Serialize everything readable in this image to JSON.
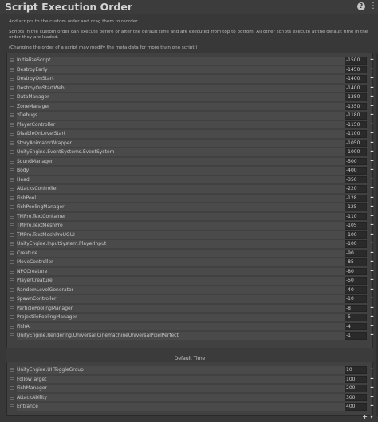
{
  "window": {
    "title": "Script Execution Order"
  },
  "description": {
    "line1": "Add scripts to the custom order and drag them to reorder.",
    "line2": "Scripts in the custom order can execute before or after the default time and are executed from top to bottom. All other scripts execute at the default time in the order they are loaded.",
    "line3": "(Changing the order of a script may modify the meta data for more than one script.)"
  },
  "before_default": [
    {
      "name": "InitializeScript",
      "value": "-1500"
    },
    {
      "name": "DestroyEarly",
      "value": "-1450"
    },
    {
      "name": "DestroyOnStart",
      "value": "-1400"
    },
    {
      "name": "DestroyOnStartWeb",
      "value": "-1400"
    },
    {
      "name": "DataManager",
      "value": "-1380"
    },
    {
      "name": "ZoneManager",
      "value": "-1350"
    },
    {
      "name": "zDebugs",
      "value": "-1180"
    },
    {
      "name": "PlayerController",
      "value": "-1150"
    },
    {
      "name": "DisableOnLevelStart",
      "value": "-1100"
    },
    {
      "name": "StoryAnimatorWrapper",
      "value": "-1050"
    },
    {
      "name": "UnityEngine.EventSystems.EventSystem",
      "value": "-1000"
    },
    {
      "name": "SoundManager",
      "value": "-500"
    },
    {
      "name": "Body",
      "value": "-400"
    },
    {
      "name": "Head",
      "value": "-350"
    },
    {
      "name": "AttacksController",
      "value": "-220"
    },
    {
      "name": "FishPool",
      "value": "-128"
    },
    {
      "name": "FishPoolingManager",
      "value": "-125"
    },
    {
      "name": "TMPro.TextContainer",
      "value": "-110"
    },
    {
      "name": "TMPro.TextMeshPro",
      "value": "-105"
    },
    {
      "name": "TMPro.TextMeshProUGUI",
      "value": "-100"
    },
    {
      "name": "UnityEngine.InputSystem.PlayerInput",
      "value": "-100"
    },
    {
      "name": "Creature",
      "value": "-90"
    },
    {
      "name": "MoveController",
      "value": "-85"
    },
    {
      "name": "NPCCreature",
      "value": "-80"
    },
    {
      "name": "PlayerCreature",
      "value": "-50"
    },
    {
      "name": "RandomLevelGenerator",
      "value": "-40"
    },
    {
      "name": "SpawnController",
      "value": "-10"
    },
    {
      "name": "ParticlePoolingManager",
      "value": "-8"
    },
    {
      "name": "ProjectilePoolingManager",
      "value": "-5"
    },
    {
      "name": "FishAI",
      "value": "-4"
    },
    {
      "name": "UnityEngine.Rendering.Universal.CinemachineUniversalPixelPerfect",
      "value": "-1"
    }
  ],
  "default_time_label": "Default Time",
  "after_default": [
    {
      "name": "UnityEngine.UI.ToggleGroup",
      "value": "10"
    },
    {
      "name": "FollowTarget",
      "value": "100"
    },
    {
      "name": "FishManager",
      "value": "200"
    },
    {
      "name": "AttackAbility",
      "value": "300"
    },
    {
      "name": "Entrance",
      "value": "400"
    }
  ],
  "footer": {
    "add_label": "+",
    "dropdown_label": "▾"
  },
  "colors": {
    "background": "#383838",
    "field": "#2a2a2a",
    "row": "#4a4a4a"
  }
}
